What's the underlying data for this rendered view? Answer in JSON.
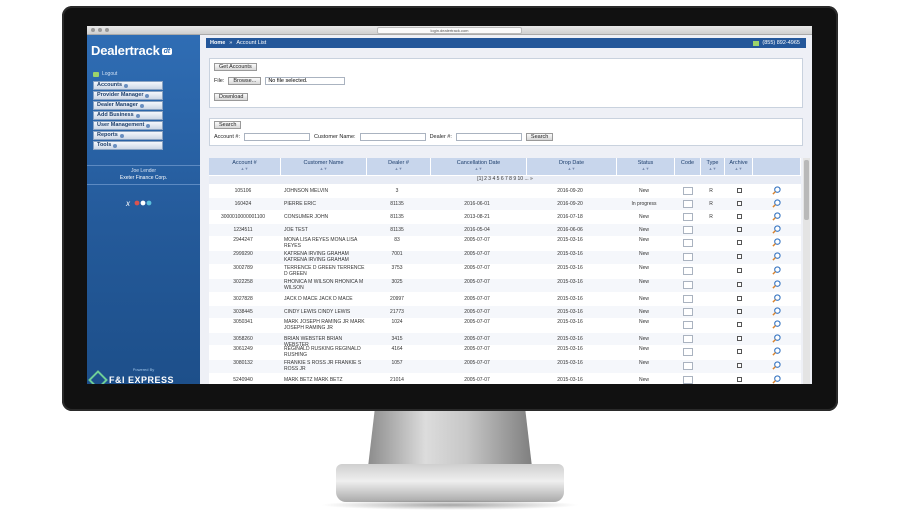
{
  "browser": {
    "url": "login.dealertrack.com"
  },
  "sidebar": {
    "logo": "Dealertrack",
    "logo_badge": "dt",
    "logout": "Logout",
    "menu": [
      {
        "label": "Accounts"
      },
      {
        "label": "Provider Manager"
      },
      {
        "label": "Dealer Manager"
      },
      {
        "label": "Add Business"
      },
      {
        "label": "User Management"
      },
      {
        "label": "Reports"
      },
      {
        "label": "Tools"
      }
    ],
    "user_name": "Joe Lender",
    "company": "Exeter Finance Corp.",
    "powered_by": "Powered By",
    "brand": "F&I EXPRESS"
  },
  "topbar": {
    "home": "Home",
    "sep": "»",
    "crumb": "Account List",
    "phone": "(855) 892-4965"
  },
  "get_accounts": {
    "tab": "Get Accounts",
    "file_label": "File:",
    "browse": "Browse...",
    "no_file": "No file selected.",
    "download": "Download"
  },
  "search": {
    "tab": "Search",
    "account_label": "Account #:",
    "customer_label": "Customer Name:",
    "dealer_label": "Dealer #:",
    "button": "Search"
  },
  "table": {
    "headers": [
      "Account #",
      "Customer Name",
      "Dealer #",
      "Cancellation Date",
      "Drop Date",
      "Status",
      "Code",
      "Type",
      "Archive"
    ],
    "sort_hint": "▲▼",
    "pager": "[1] 2 3 4 5 6 7 8 9 10 ... »",
    "rows": [
      {
        "account": "105106",
        "customer": "JOHNSON MELVIN",
        "dealer": "3",
        "cancel": "",
        "drop": "2016-09-20",
        "status": "New",
        "type": "R"
      },
      {
        "account": "160424",
        "customer": "PIERRE ERIC",
        "dealer": "81135",
        "cancel": "2016-06-01",
        "drop": "2016-09-20",
        "status": "In progress",
        "type": "R"
      },
      {
        "account": "3000010000001100",
        "customer": "CONSUMER JOHN",
        "dealer": "81135",
        "cancel": "2013-08-21",
        "drop": "2016-07-18",
        "status": "New",
        "type": "R"
      },
      {
        "account": "1234511",
        "customer": "JOE TEST",
        "dealer": "81135",
        "cancel": "2016-05-04",
        "drop": "2016-06-06",
        "status": "New",
        "type": ""
      },
      {
        "account": "2944247",
        "customer": "MONA LISA REYES MONA LISA REYES",
        "dealer": "83",
        "cancel": "2005-07-07",
        "drop": "2015-03-16",
        "status": "New",
        "type": ""
      },
      {
        "account": "2999290",
        "customer": "KATRENA IRVING GRAHAM KATRENA IRVING GRAHAM",
        "dealer": "7001",
        "cancel": "2005-07-07",
        "drop": "2015-03-16",
        "status": "New",
        "type": ""
      },
      {
        "account": "3002789",
        "customer": "TERRENCE D GREEN TERRENCE D GREEN",
        "dealer": "3753",
        "cancel": "2005-07-07",
        "drop": "2015-03-16",
        "status": "New",
        "type": ""
      },
      {
        "account": "3022258",
        "customer": "RHONICA M WILSON RHONICA M WILSON",
        "dealer": "3025",
        "cancel": "2005-07-07",
        "drop": "2015-03-16",
        "status": "New",
        "type": ""
      },
      {
        "account": "3027828",
        "customer": "JACK D MACE JACK D MACE",
        "dealer": "20997",
        "cancel": "2005-07-07",
        "drop": "2015-03-16",
        "status": "New",
        "type": ""
      },
      {
        "account": "3038445",
        "customer": "CINDY LEWIS CINDY LEWIS",
        "dealer": "21773",
        "cancel": "2005-07-07",
        "drop": "2015-03-16",
        "status": "New",
        "type": ""
      },
      {
        "account": "3050341",
        "customer": "MARK JOSEPH RAMING JR MARK JOSEPH RAMING JR",
        "dealer": "1024",
        "cancel": "2005-07-07",
        "drop": "2015-03-16",
        "status": "New",
        "type": ""
      },
      {
        "account": "3058260",
        "customer": "BRIAN WEBSTER BRIAN WEBSTER",
        "dealer": "3415",
        "cancel": "2005-07-07",
        "drop": "2015-03-16",
        "status": "New",
        "type": ""
      },
      {
        "account": "3061249",
        "customer": "REGINALD RUSKING REGINALD RUSHING",
        "dealer": "4164",
        "cancel": "2005-07-07",
        "drop": "2015-03-16",
        "status": "New",
        "type": ""
      },
      {
        "account": "3080132",
        "customer": "FRANKIE S ROSS JR FRANKIE S ROSS JR",
        "dealer": "1057",
        "cancel": "2005-07-07",
        "drop": "2015-03-16",
        "status": "New",
        "type": ""
      },
      {
        "account": "5240940",
        "customer": "MARK BETZ MARK BETZ",
        "dealer": "21014",
        "cancel": "2005-07-07",
        "drop": "2015-03-16",
        "status": "New",
        "type": ""
      }
    ]
  }
}
